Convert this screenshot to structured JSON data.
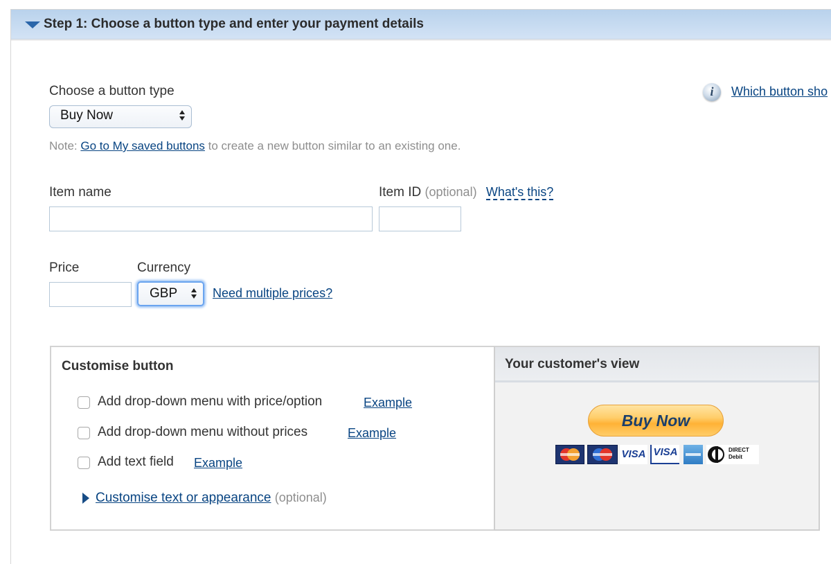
{
  "step": {
    "title": "Step 1: Choose a button type and enter your payment details",
    "expanded": true
  },
  "button_type": {
    "label": "Choose a button type",
    "selected": "Buy Now"
  },
  "help_link": "Which button sho",
  "note": {
    "prefix": "Note:",
    "link": "Go to My saved buttons",
    "suffix": "to create a new button similar to an existing one."
  },
  "item_name": {
    "label": "Item name",
    "value": "",
    "placeholder": ""
  },
  "item_id": {
    "label": "Item ID",
    "optional": "(optional)",
    "help_link": "What's this?",
    "value": ""
  },
  "price": {
    "label": "Price",
    "value": ""
  },
  "currency": {
    "label": "Currency",
    "selected": "GBP",
    "multiple_prices_link": "Need multiple prices?"
  },
  "customise": {
    "title": "Customise button",
    "options": [
      {
        "label": "Add drop-down menu with price/option",
        "checked": false,
        "link": "Example"
      },
      {
        "label": "Add drop-down menu without prices",
        "checked": false,
        "link": "Example"
      },
      {
        "label": "Add text field",
        "checked": false,
        "link": "Example"
      }
    ],
    "appearance_link": "Customise text or appearance",
    "appearance_optional": "(optional)"
  },
  "customer_view": {
    "title": "Your customer's view",
    "button_label": "Buy Now",
    "payment_logos": [
      "Maestro/MasterCard",
      "Maestro",
      "VISA",
      "VISA Electron",
      "American Express",
      "Direct Debit"
    ],
    "direct_debit_text": "DIRECT Debit",
    "visa_text": "VISA"
  },
  "colors": {
    "link": "#084482",
    "header_bg": "#c6dbf1",
    "buy_button": "#ffc14f"
  }
}
